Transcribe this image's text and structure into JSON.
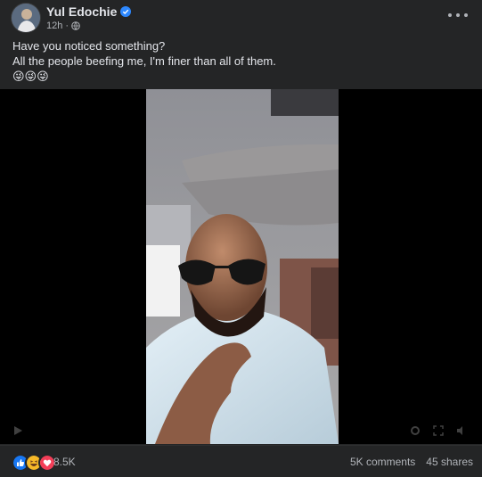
{
  "post": {
    "author": "Yul Edochie",
    "time": "12h",
    "separator": "·",
    "text_line1": "Have you noticed something?",
    "text_line2": "All the people beefing me, I'm finer than all of them.",
    "emojis": "😜😜😜",
    "reaction_count": "8.5K",
    "comments": "5K comments",
    "shares": "45 shares"
  },
  "icons": {
    "verified": "verified-badge-icon",
    "audience": "globe-icon",
    "more": "more-options-icon",
    "reactions": [
      "like-icon",
      "haha-icon",
      "love-icon"
    ]
  },
  "colors": {
    "background": "#242526",
    "text": "#e4e6eb",
    "secondary_text": "#b0b3b8",
    "verified_blue": "#2d88ff",
    "like_blue": "#1877f2",
    "haha_yellow": "#f7b928",
    "love_red": "#f33e58"
  }
}
